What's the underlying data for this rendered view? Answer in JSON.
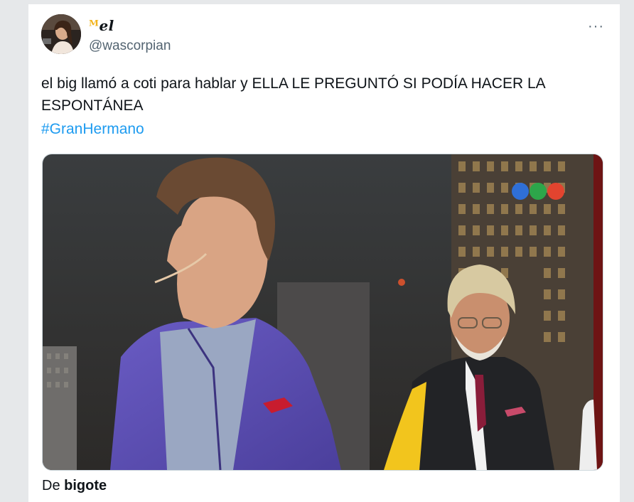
{
  "tweet": {
    "display_name": "el",
    "name_ornament": "ᴹ",
    "handle": "@wascorpian",
    "more_label": "···",
    "text": "el big llamó a coti para hablar y ELLA LE PREGUNTÓ SI PODÍA HACER LA ESPONTÁNEA",
    "hashtag": "#GranHermano",
    "caption_prefix": "De",
    "caption_bold": "bigote"
  },
  "colors": {
    "link": "#1d9bf0",
    "secondary_text": "#536471",
    "name_ornament": "#f2b31a"
  },
  "icons": {
    "more": "more-horizontal-icon",
    "tv_logo": "telefe-logo-icon"
  }
}
